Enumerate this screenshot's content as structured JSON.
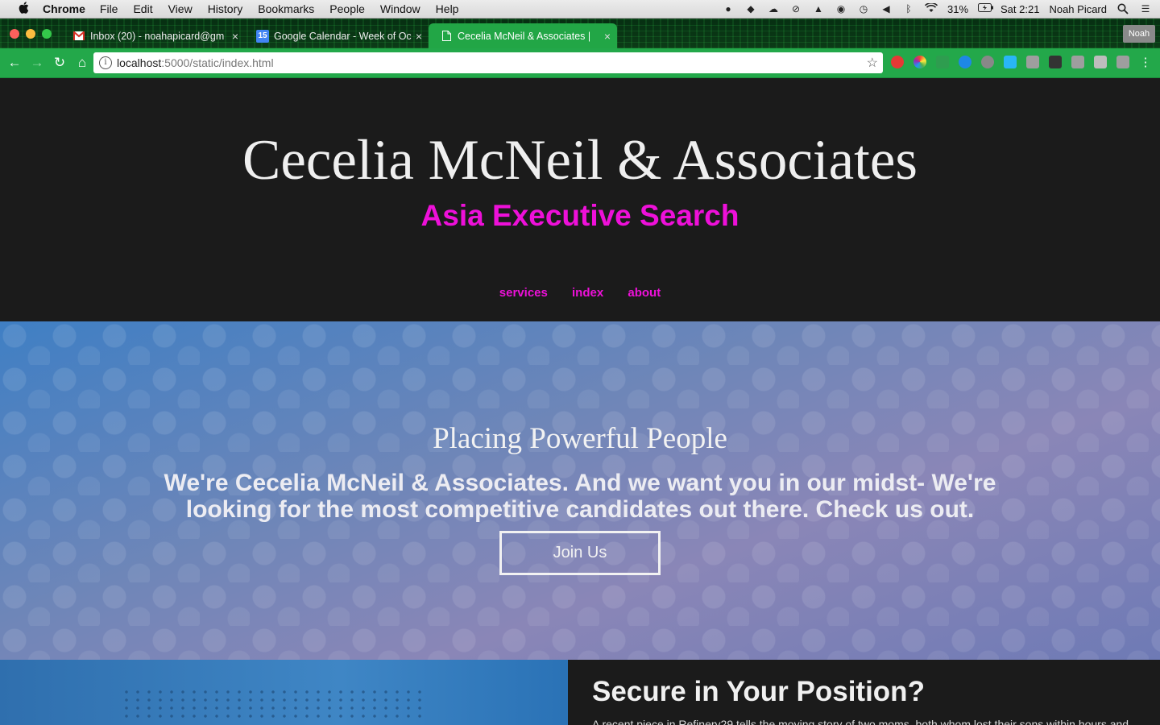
{
  "menubar": {
    "apple": "",
    "app": "Chrome",
    "items": [
      "File",
      "Edit",
      "View",
      "History",
      "Bookmarks",
      "People",
      "Window",
      "Help"
    ],
    "battery": "31%",
    "clock": "Sat 2:21",
    "user": "Noah Picard"
  },
  "tabs": [
    {
      "title": "Inbox (20) - noahapicard@gm",
      "close": "×"
    },
    {
      "title": "Google Calendar - Week of Oc",
      "close": "×",
      "fav": "15"
    },
    {
      "title": "Cecelia McNeil & Associates | ",
      "close": "×"
    }
  ],
  "profile": "Noah",
  "omnibox": {
    "host": "localhost",
    "path": ":5000/static/index.html"
  },
  "site": {
    "title": "Cecelia McNeil & Associates",
    "subtitle": "Asia Executive Search",
    "nav": [
      "services",
      "index",
      "about"
    ]
  },
  "hero": {
    "title": "Placing Powerful People",
    "text": "We're Cecelia McNeil & Associates. And we want you in our midst- We're looking for the most competitive candidates out there. Check us out.",
    "button": "Join Us"
  },
  "section2": {
    "title": "Secure in Your Position?",
    "text": "A recent piece in Refinery29 tells the moving story of two moms, both whom lost their sons within hours and"
  },
  "colors": {
    "accent": "#ee10d9",
    "toolbar": "#23a84a",
    "header_bg": "#1b1b1b"
  }
}
